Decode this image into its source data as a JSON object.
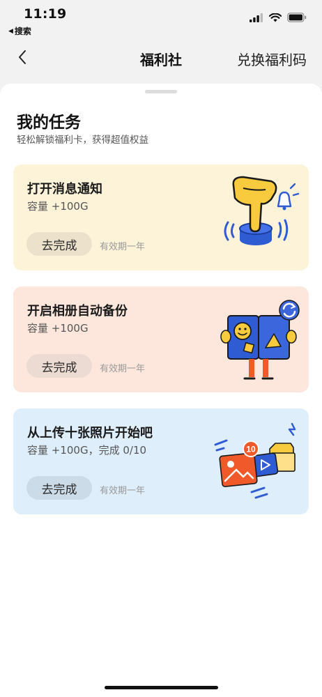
{
  "status_bar": {
    "time": "11:19",
    "back_app": "搜索"
  },
  "nav": {
    "title": "福利社",
    "right_action": "兑换福利码"
  },
  "section": {
    "title": "我的任务",
    "subtitle": "轻松解锁福利卡，获得超值权益"
  },
  "tasks": [
    {
      "title": "打开消息通知",
      "reward": "容量 +100G",
      "button": "去完成",
      "validity": "有效期一年",
      "bg_color": "#fdf3d9",
      "button_color": "#ece2cb",
      "icon": "notification-bell-illustration"
    },
    {
      "title": "开启相册自动备份",
      "reward": "容量 +100G",
      "button": "去完成",
      "validity": "有效期一年",
      "bg_color": "#fde7dc",
      "button_color": "#ecdbd3",
      "icon": "album-backup-illustration"
    },
    {
      "title": "从上传十张照片开始吧",
      "reward": "容量 +100G，完成 0/10",
      "button": "去完成",
      "validity": "有效期一年",
      "bg_color": "#dfeefb",
      "button_color": "#ccdbe8",
      "icon": "upload-photos-illustration"
    }
  ],
  "illustration_badge": "10"
}
